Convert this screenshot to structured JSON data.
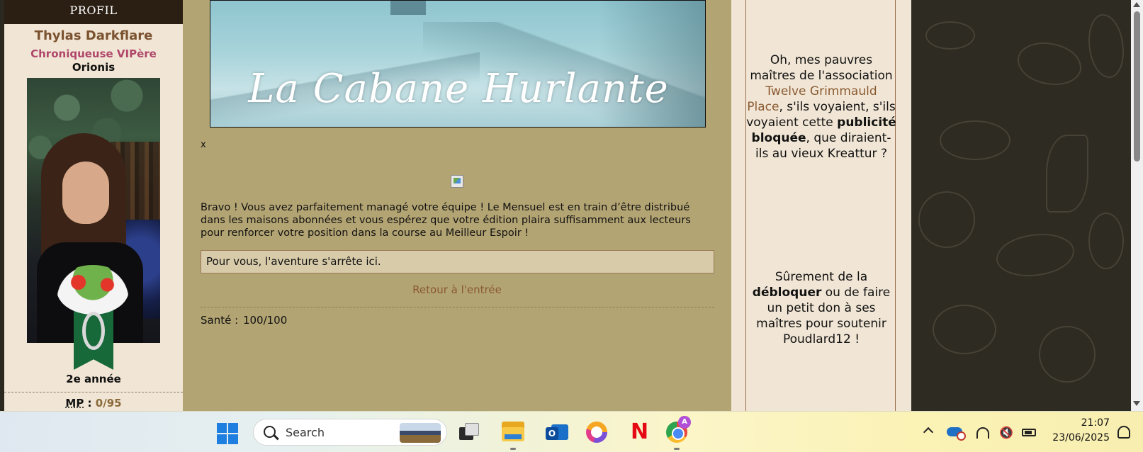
{
  "profile": {
    "header": "PROFIL",
    "name": "Thylas Darkflare",
    "role": "Chroniqueuse VIPère",
    "house": "Orionis",
    "year": "2e année",
    "mp_label": "MP",
    "mp_sep": " : ",
    "mp_value": "0/95"
  },
  "main": {
    "banner_title": "La Cabane Hurlante",
    "close_label": "x",
    "message": "Bravo ! Vous avez parfaitement managé votre équipe ! Le Mensuel est en train d’être distribué dans les maisons abonnées et vous espérez que votre édition plaira suffisamment aux lecteurs pour renforcer votre position dans la course au Meilleur Espoir !",
    "result": "Pour vous, l'aventure s'arrête ici.",
    "back_link": "Retour à l'entrée",
    "health_label": "Santé :",
    "health_value": "100/100"
  },
  "ad": {
    "p1_before": "Oh, mes pauvres maîtres de l'association ",
    "p1_link": "Twelve Grimmauld Place",
    "p1_mid": ", s'ils voyaient, s'ils voyaient cette ",
    "p1_bold": "publicité bloquée",
    "p1_after": ", que diraient-ils au vieux Kreattur ?",
    "p2_before": "Sûrement de la ",
    "p2_bold": "débloquer",
    "p2_after": " ou de faire un petit don à ses maîtres pour soutenir Poudlard12 !"
  },
  "taskbar": {
    "search_label": "Search",
    "chrome_badge": "A",
    "netflix_glyph": "N",
    "outlook_glyph": "O",
    "volume_glyph": "🔇",
    "time": "21:07",
    "date": "23/06/2025",
    "icons": [
      "start-icon",
      "search-icon",
      "task-view-icon",
      "file-explorer-icon",
      "outlook-icon",
      "vpn-icon",
      "netflix-icon",
      "chrome-icon",
      "tray-chevron-icon",
      "onedrive-icon",
      "wifi-icon",
      "volume-muted-icon",
      "battery-icon",
      "notification-bell-icon"
    ]
  },
  "colors": {
    "main_bg": "#b3a473",
    "sidebar_bg": "#f1e6d5",
    "link": "#8a5a32",
    "role": "#b0476b"
  }
}
